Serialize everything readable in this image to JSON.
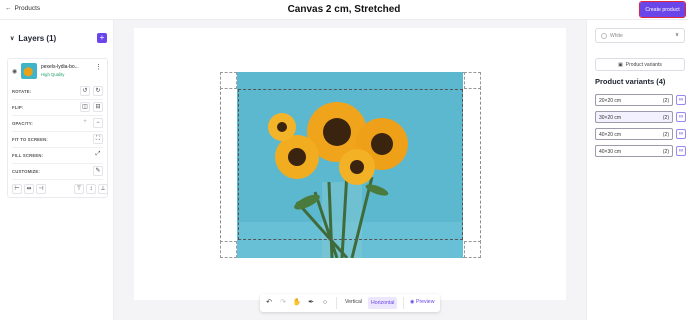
{
  "header": {
    "back_label": "Products",
    "title": "Canvas 2 cm, Stretched",
    "create_label": "Create product"
  },
  "layers": {
    "title": "Layers (1)",
    "add_label": "+",
    "layer": {
      "name": "pexels-lydia-bo...",
      "quality": "High Quality"
    },
    "props": {
      "rotate": "ROTATE:",
      "flip": "FLIP:",
      "opacity": "OPACITY:",
      "fit": "FIT TO SCREEN:",
      "fill": "FILL SCREEN:",
      "customize": "CUSTOMIZE:"
    }
  },
  "toolbar": {
    "vertical": "Vertical",
    "horizontal": "Horizontal",
    "preview": "Preview"
  },
  "right": {
    "color_select": "White",
    "product_variants_button": "Product variants",
    "variants_title": "Product variants (4)",
    "variants": [
      {
        "label": "20×20 cm",
        "count": "(2)",
        "selected": false
      },
      {
        "label": "30×20 cm",
        "count": "(2)",
        "selected": true
      },
      {
        "label": "40×20 cm",
        "count": "(2)",
        "selected": false
      },
      {
        "label": "40×30 cm",
        "count": "(2)",
        "selected": false
      }
    ]
  },
  "colors": {
    "accent": "#6a45ea",
    "highlight": "#e0263a",
    "photo_bg": "#5cb8cf"
  }
}
